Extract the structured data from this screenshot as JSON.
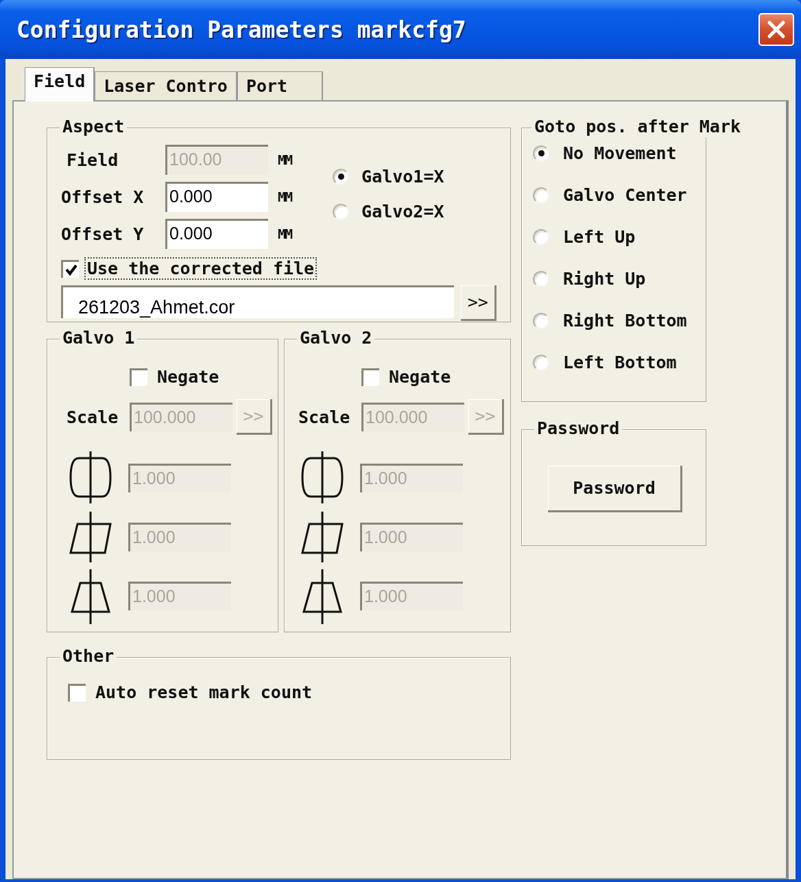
{
  "window": {
    "title": "Configuration Parameters markcfg7"
  },
  "tabs": [
    {
      "label": "Field",
      "selected": true
    },
    {
      "label": "Laser Contro",
      "selected": false
    },
    {
      "label": "Port",
      "selected": false
    }
  ],
  "aspect": {
    "title": "Aspect",
    "fields": [
      {
        "label": "Field",
        "value": "100.00",
        "unit": "MM",
        "disabled": true
      },
      {
        "label": "Offset X",
        "value": "0.000",
        "unit": "MM",
        "disabled": false
      },
      {
        "label": "Offset Y",
        "value": "0.000",
        "unit": "MM",
        "disabled": false
      }
    ],
    "axis_options": [
      {
        "label": "Galvo1=X",
        "selected": true
      },
      {
        "label": "Galvo2=X",
        "selected": false
      }
    ],
    "use_corrected_file": {
      "label": "Use the corrected file",
      "checked": true
    },
    "file_path": "261203_Ahmet.cor",
    "browse_button": ">>"
  },
  "galvos": [
    {
      "title": "Galvo 1",
      "negate": {
        "label": "Negate",
        "checked": false
      },
      "scale": {
        "label": "Scale",
        "value": "100.000",
        "button": ">>",
        "disabled": true
      },
      "corrections": [
        {
          "kind": "barrel",
          "value": "1.000",
          "disabled": true
        },
        {
          "kind": "parallelogram",
          "value": "1.000",
          "disabled": true
        },
        {
          "kind": "trapezoid",
          "value": "1.000",
          "disabled": true
        }
      ]
    },
    {
      "title": "Galvo 2",
      "negate": {
        "label": "Negate",
        "checked": false
      },
      "scale": {
        "label": "Scale",
        "value": "100.000",
        "button": ">>",
        "disabled": true
      },
      "corrections": [
        {
          "kind": "barrel",
          "value": "1.000",
          "disabled": true
        },
        {
          "kind": "parallelogram",
          "value": "1.000",
          "disabled": true
        },
        {
          "kind": "trapezoid",
          "value": "1.000",
          "disabled": true
        }
      ]
    }
  ],
  "other": {
    "title": "Other",
    "options": [
      {
        "label": "Auto reset mark count",
        "checked": false
      }
    ]
  },
  "goto": {
    "title": "Goto pos. after Mark",
    "options": [
      {
        "label": "No Movement",
        "selected": true
      },
      {
        "label": "Galvo Center",
        "selected": false
      },
      {
        "label": "Left Up",
        "selected": false
      },
      {
        "label": "Right Up",
        "selected": false
      },
      {
        "label": "Right Bottom",
        "selected": false
      },
      {
        "label": "Left Bottom",
        "selected": false
      }
    ]
  },
  "password": {
    "title": "Password",
    "button": "Password"
  }
}
